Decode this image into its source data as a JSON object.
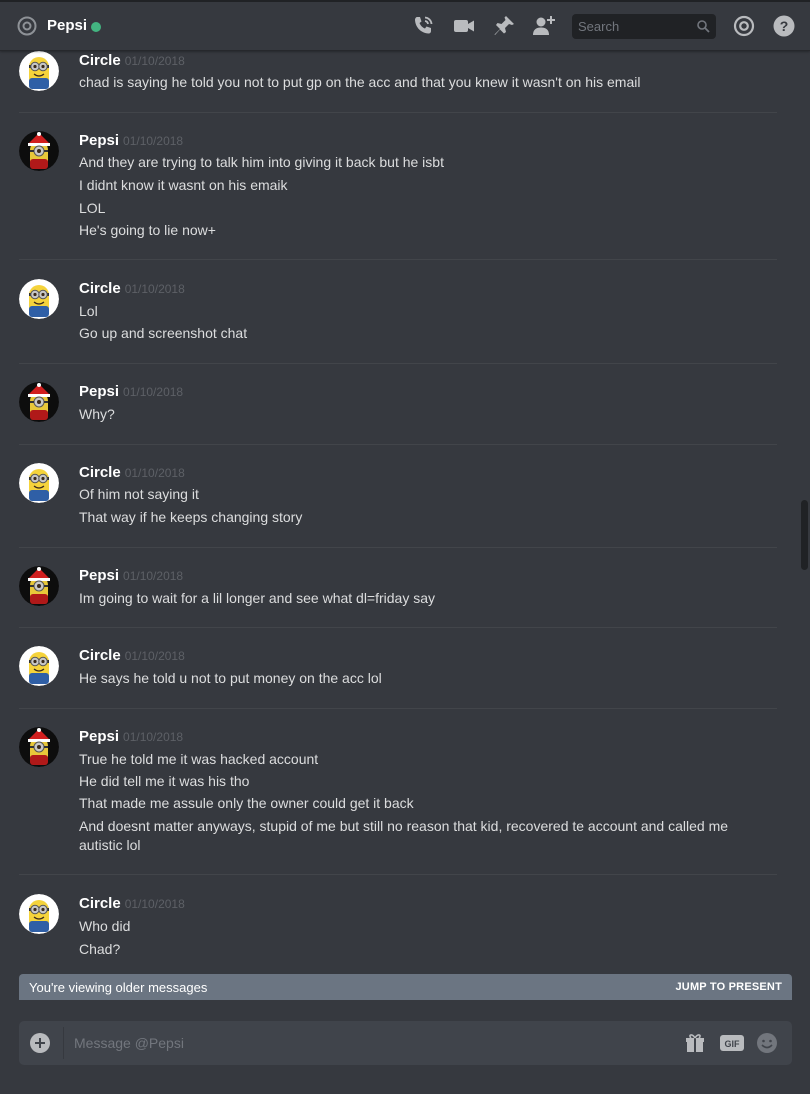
{
  "header": {
    "title": "Pepsi",
    "status_color": "#43b581",
    "icons": [
      "at-icon",
      "call-icon",
      "video-icon",
      "pin-icon",
      "add-friend-icon",
      "mentions-icon",
      "help-icon"
    ]
  },
  "search": {
    "placeholder": "Search"
  },
  "messages": [
    {
      "author": "Circle",
      "timestamp": "01/10/2018",
      "avatar": "minion-avatar",
      "lines": [
        "chad is saying he told you not to put gp on the acc and that you knew it wasn't on his email"
      ]
    },
    {
      "author": "Pepsi",
      "timestamp": "01/10/2018",
      "avatar": "minion-santa-avatar",
      "lines": [
        "And they are trying to talk him into giving it back but he isbt",
        "I didnt know it wasnt on his emaik",
        "LOL",
        "He's going to lie now+"
      ]
    },
    {
      "author": "Circle",
      "timestamp": "01/10/2018",
      "avatar": "minion-avatar",
      "lines": [
        "Lol",
        "Go up and screenshot chat"
      ]
    },
    {
      "author": "Pepsi",
      "timestamp": "01/10/2018",
      "avatar": "minion-santa-avatar",
      "lines": [
        "Why?"
      ]
    },
    {
      "author": "Circle",
      "timestamp": "01/10/2018",
      "avatar": "minion-avatar",
      "lines": [
        "Of him not saying it",
        "That way if he keeps changing story"
      ]
    },
    {
      "author": "Pepsi",
      "timestamp": "01/10/2018",
      "avatar": "minion-santa-avatar",
      "lines": [
        "Im going to wait for a lil longer and see what dl=friday say"
      ]
    },
    {
      "author": "Circle",
      "timestamp": "01/10/2018",
      "avatar": "minion-avatar",
      "lines": [
        "He says he told u not to put money on the acc lol"
      ]
    },
    {
      "author": "Pepsi",
      "timestamp": "01/10/2018",
      "avatar": "minion-santa-avatar",
      "lines": [
        "True he told me it was hacked account",
        "He did tell me it was his tho",
        "That made me assule only the owner could get it back",
        "And doesnt matter anyways, stupid of me but still no reason that kid, recovered te account and called me autistic lol"
      ]
    },
    {
      "author": "Circle",
      "timestamp": "01/10/2018",
      "avatar": "minion-avatar",
      "lines": [
        "Who did",
        "Chad?"
      ]
    }
  ],
  "older_banner": {
    "text": "You're viewing older messages",
    "jump_label": "JUMP TO PRESENT"
  },
  "composer": {
    "placeholder": "Message @Pepsi",
    "gif_label": "GIF"
  },
  "colors": {
    "background": "#36393f",
    "username": "#ffffff",
    "timestamp": "#5d6066",
    "banner": "#6b7582"
  }
}
